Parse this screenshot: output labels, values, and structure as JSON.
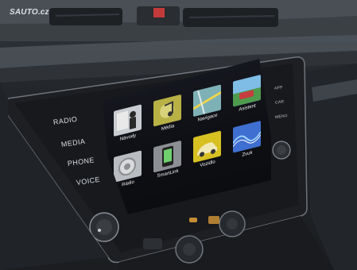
{
  "watermark": "SAUTO.cz",
  "hardware_buttons": {
    "radio": "RADIO",
    "media": "MEDIA",
    "phone": "PHONE",
    "voice": "VOICE"
  },
  "right_buttons": [
    "APP",
    "CAR",
    "MENU"
  ],
  "tiles": [
    {
      "label": "Návody",
      "icon": "manual-icon",
      "color": "#c7c9cb"
    },
    {
      "label": "Média",
      "icon": "media-icon",
      "color": "#b8b145"
    },
    {
      "label": "Navigace",
      "icon": "navigation-icon",
      "color": "#6aa0b0"
    },
    {
      "label": "Asistent",
      "icon": "assistant-icon",
      "color": "#4b8cb3"
    },
    {
      "label": "Rádio",
      "icon": "radio-icon",
      "color": "#b9bcc0"
    },
    {
      "label": "SmartLink",
      "icon": "smartlink-icon",
      "color": "#8c8f93"
    },
    {
      "label": "Vozidlo",
      "icon": "vehicle-icon",
      "color": "#d7c022"
    },
    {
      "label": "Zvuk",
      "icon": "sound-icon",
      "color": "#3f6fd0"
    }
  ],
  "page_dots": "• • •"
}
